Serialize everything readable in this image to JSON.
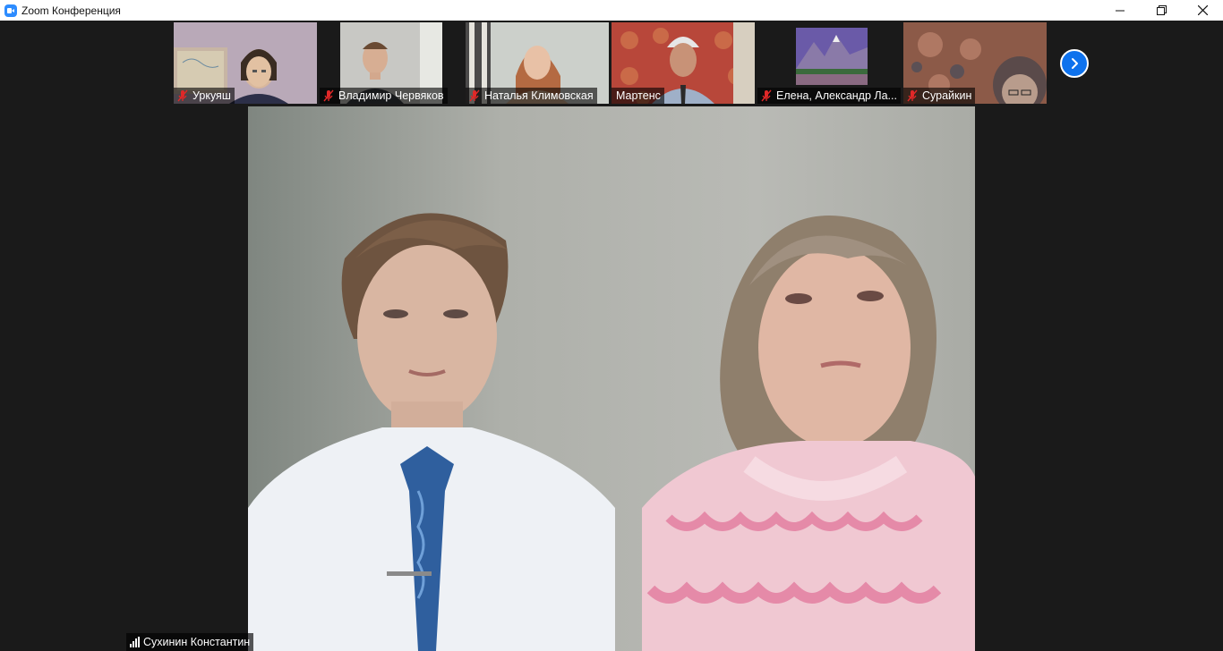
{
  "window": {
    "title": "Zoom Конференция",
    "app_icon": "zoom-camera-icon"
  },
  "gallery": {
    "participants": [
      {
        "name": "Уркуяш",
        "muted": true
      },
      {
        "name": "Владимир Червяков",
        "muted": true
      },
      {
        "name": "Наталья Климовская",
        "muted": true
      },
      {
        "name": "Мартенс",
        "muted": false
      },
      {
        "name": "Елена, Александр Ла...",
        "muted": true
      },
      {
        "name": "Сурайкин",
        "muted": true
      }
    ],
    "next_icon": "chevron-right-icon"
  },
  "active_speaker": {
    "name": "Сухинин Константин",
    "icon": "signal-bars-icon"
  },
  "colors": {
    "accent": "#0e72ed",
    "mute_red": "#e02828",
    "background": "#1a1a1a"
  }
}
